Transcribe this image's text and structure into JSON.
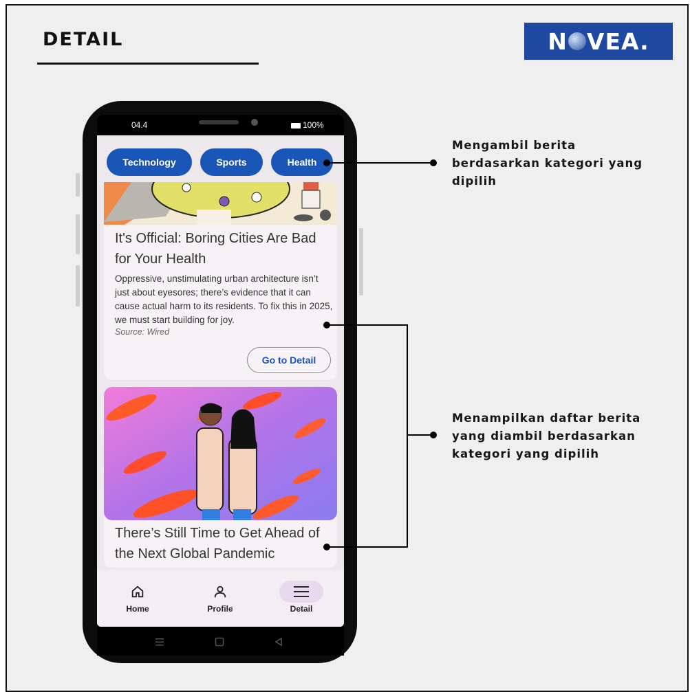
{
  "page": {
    "title": "DETAIL",
    "logo_left": "N",
    "logo_right": "VEA."
  },
  "status": {
    "time": "04.4",
    "battery": "100%"
  },
  "categories": [
    "Technology",
    "Sports",
    "Health"
  ],
  "articles": [
    {
      "headline": "It's Official: Boring Cities Are Bad for Your Health",
      "description": "Oppressive, unstimulating urban architecture isn’t just about eyesores; there’s evidence that it can cause actual harm to its residents. To fix this in 2025, we must start building for joy.",
      "source": "Source: Wired",
      "button": "Go to Detail"
    },
    {
      "headline": "There’s Still Time to Get Ahead of the Next Global Pandemic"
    }
  ],
  "nav": {
    "home": "Home",
    "profile": "Profile",
    "detail": "Detail"
  },
  "annotations": {
    "category": "Mengambil berita berdasarkan kategori yang dipilih",
    "list": "Menampilkan daftar berita yang diambil berdasarkan kategori yang dipilih"
  },
  "colors": {
    "primary": "#1a56b8",
    "logo_bg": "#1f49a0",
    "nav_active": "#e8d9ef"
  }
}
